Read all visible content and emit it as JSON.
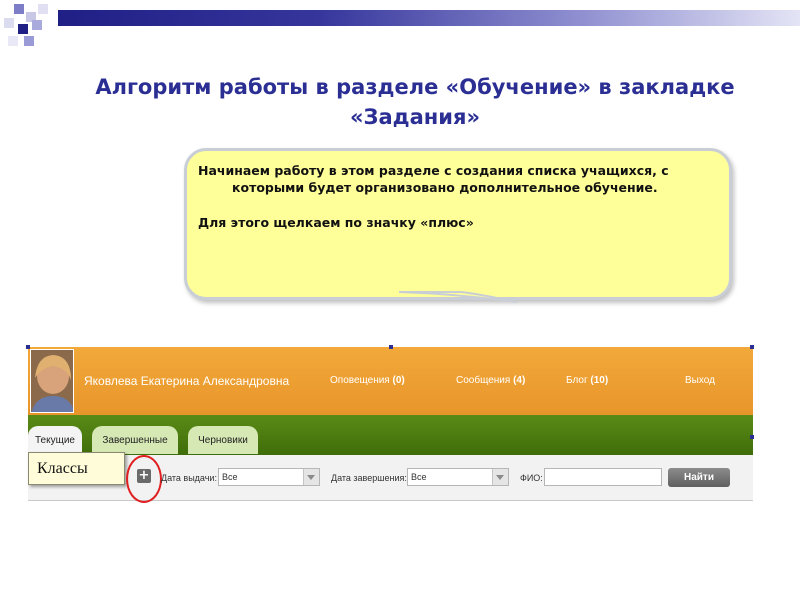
{
  "slide": {
    "title_line1": "Алгоритм работы в разделе «Обучение» в закладке",
    "title_line2": "«Задания»"
  },
  "callout": {
    "paragraph1": "Начинаем работу в этом разделе с создания списка учащихся, с которыми будет организовано дополнительное обучение.",
    "paragraph2": "Для этого щелкаем по значку «плюс»"
  },
  "screenshot": {
    "user_name": "Яковлева Екатерина Александровна",
    "nav": [
      {
        "label": "Оповещения",
        "count": "(0)"
      },
      {
        "label": "Сообщения",
        "count": "(4)"
      },
      {
        "label": "Блог",
        "count": "(10)"
      },
      {
        "label": "Выход",
        "count": ""
      }
    ],
    "tabs": [
      "Текущие",
      "Завершенные",
      "Черновики"
    ],
    "classes_label": "Классы",
    "filters": {
      "issue_date_label": "Дата выдачи:",
      "issue_date_value": "Все",
      "end_date_label": "Дата завершения:",
      "end_date_value": "Все",
      "fio_label": "ФИО:",
      "find_button": "Найти"
    }
  },
  "colors": {
    "title": "#2b2f94",
    "callout_bg": "#ffff9a",
    "header_orange": "#e8952a",
    "band_green": "#4a7a10",
    "highlight_ring": "#e02020"
  },
  "icons": [
    "plus-icon",
    "dropdown-arrow-icon"
  ]
}
